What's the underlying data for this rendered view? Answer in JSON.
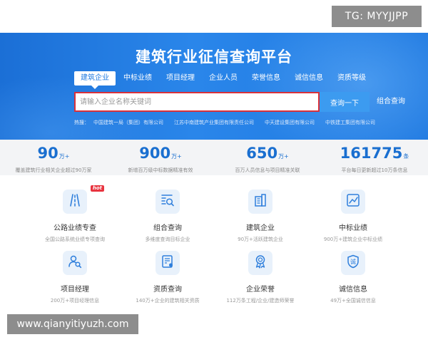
{
  "watermark_top": "TG: MYYJJPP",
  "watermark_bottom": "www.qianyitiyuzh.com",
  "hero": {
    "title": "建筑行业征信查询平台",
    "tabs": [
      "建筑企业",
      "中标业绩",
      "项目经理",
      "企业人员",
      "荣誉信息",
      "诚信信息",
      "资质等级"
    ],
    "active_tab": "建筑企业",
    "search_placeholder": "请输入企业名称关键词",
    "search_button": "查询一下",
    "combo_link": "组合查询",
    "hot_label": "热搜：",
    "hot_items": [
      "中国建筑一局（集团）有限公司",
      "江苏中南建筑产业集团有限责任公司",
      "中天建设集团有限公司",
      "中铁建工集团有限公司"
    ]
  },
  "stats": [
    {
      "number": "90",
      "unit": "万+",
      "desc": "覆盖建筑行业相关企业超过90万家"
    },
    {
      "number": "900",
      "unit": "万+",
      "desc": "新增百万级中标数据精准有效"
    },
    {
      "number": "650",
      "unit": "万+",
      "desc": "百万人员信息与项目精准关联"
    },
    {
      "number": "161775",
      "unit": "条",
      "desc": "平台每日更新超过10万条信息"
    }
  ],
  "features": [
    {
      "title": "公路业绩专查",
      "desc": "全国公路系统业绩专项查询",
      "icon": "road-icon",
      "hot": "hot"
    },
    {
      "title": "组合查询",
      "desc": "多维度查询目标企业",
      "icon": "search-list-icon"
    },
    {
      "title": "建筑企业",
      "desc": "90万+活跃建筑企业",
      "icon": "building-icon"
    },
    {
      "title": "中标业绩",
      "desc": "900万+建筑企业中标业绩",
      "icon": "chart-icon"
    },
    {
      "title": "项目经理",
      "desc": "200万+项目经理信息",
      "icon": "user-search-icon"
    },
    {
      "title": "资质查询",
      "desc": "140万+企业的建筑相关资质",
      "icon": "certificate-icon"
    },
    {
      "title": "企业荣誉",
      "desc": "112万条工程/企业/建造师荣誉",
      "icon": "medal-icon"
    },
    {
      "title": "诚信信息",
      "desc": "49万+全国诚信信息",
      "icon": "shield-icon",
      "glyph": "诚"
    }
  ],
  "colors": {
    "primary": "#1f7ae0",
    "stat_blue": "#1a6fd0",
    "hot_red": "#e8343f",
    "search_border": "#d9313a"
  }
}
